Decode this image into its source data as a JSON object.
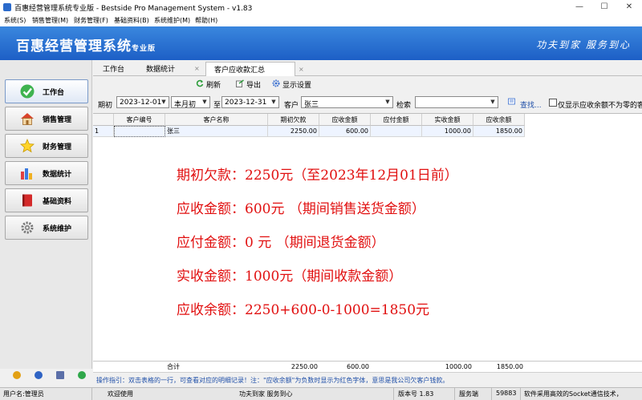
{
  "window": {
    "title": "百惠经营管理系统专业版 - Bestside Pro Management System - v1.83",
    "min": "—",
    "max": "☐",
    "close": "✕"
  },
  "menu": [
    "系统(S)",
    "销售管理(M)",
    "财务管理(F)",
    "基础资料(B)",
    "系统维护(M)",
    "帮助(H)"
  ],
  "banner": {
    "brand": "百惠经营管理系统",
    "edition": "专业版",
    "slogan": "功夫到家  服务到心"
  },
  "nav": [
    {
      "label": "工作台",
      "icon": "check-icon"
    },
    {
      "label": "销售管理",
      "icon": "house-icon"
    },
    {
      "label": "财务管理",
      "icon": "star-icon"
    },
    {
      "label": "数据统计",
      "icon": "bar-chart-icon"
    },
    {
      "label": "基础资料",
      "icon": "book-icon"
    },
    {
      "label": "系统维护",
      "icon": "gear-icon"
    }
  ],
  "tabs": [
    {
      "label": "工作台"
    },
    {
      "label": "数据统计",
      "close": "×"
    },
    {
      "label": "客户应收款汇总",
      "close": "×"
    }
  ],
  "toolbar": {
    "refresh": "刷新",
    "export": "导出",
    "display_settings": "显示设置"
  },
  "filters": {
    "period_label": "期初",
    "date_from": "2023-12-01",
    "period_type": "本月初",
    "to_label": "至",
    "date_to": "2023-12-31",
    "customer_label": "客户",
    "customer_value": "张三",
    "search_label": "检索",
    "search_value": "",
    "find_label": "查找...",
    "only_nonzero_label": "仅显示应收余额不为零的客"
  },
  "table": {
    "columns": [
      "",
      "客户编号",
      "客户名称",
      "期初欠款",
      "应收金额",
      "应付金额",
      "实收金额",
      "应收余额"
    ],
    "rows": [
      {
        "idx": "1",
        "code": "",
        "name": "张三",
        "opening": "2250.00",
        "receivable": "600.00",
        "payable": "",
        "received": "1000.00",
        "balance": "1850.00"
      }
    ],
    "footer": {
      "label": "合计",
      "opening": "2250.00",
      "receivable": "600.00",
      "payable": "",
      "received": "1000.00",
      "balance": "1850.00"
    }
  },
  "annotations": [
    "期初欠款：2250元（至2023年12月01日前）",
    "应收金额：600元  （期间销售送货金额）",
    "应付金额：0    元  （期间退货金额）",
    "实收金额：1000元（期间收款金额）",
    "应收余额：2250+600-0-1000=1850元"
  ],
  "hint": "操作指引：双击表格的一行，可查看对应的明细记录！注：\"应收余额\"为负数时显示为红色字体，意思是我公司欠客户钱款。",
  "status": {
    "user": "用户名:管理员",
    "welcome": "欢迎使用",
    "slogan": "功夫到家 服务到心",
    "version": "版本号 1.83",
    "server_label": "服务端",
    "port": "59883",
    "info": "软件采用高效的Socket通信技术，"
  },
  "colors": {
    "banner": "#1d5fc6",
    "annotation": "#e11010",
    "hint": "#1f4fa8"
  }
}
